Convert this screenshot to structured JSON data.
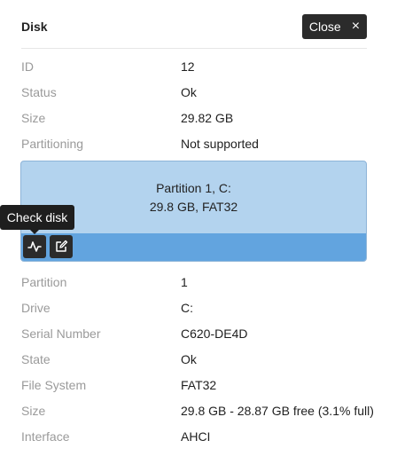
{
  "header": {
    "title": "Disk",
    "close_label": "Close",
    "close_icon": "×"
  },
  "disk": [
    {
      "label": "ID",
      "value": "12"
    },
    {
      "label": "Status",
      "value": "Ok"
    },
    {
      "label": "Size",
      "value": "29.82 GB"
    },
    {
      "label": "Partitioning",
      "value": "Not supported"
    }
  ],
  "partition_card": {
    "line1": "Partition 1, C:",
    "line2": "29.8 GB, FAT32",
    "tooltip": "Check disk",
    "check_icon": "activity-icon",
    "edit_icon": "edit-icon"
  },
  "partition": [
    {
      "label": "Partition",
      "value": "1"
    },
    {
      "label": "Drive",
      "value": "C:"
    },
    {
      "label": "Serial Number",
      "value": "C620-DE4D"
    },
    {
      "label": "State",
      "value": "Ok"
    },
    {
      "label": "File System",
      "value": "FAT32"
    },
    {
      "label": "Size",
      "value": "29.8 GB - 28.87 GB free (3.1% full)"
    },
    {
      "label": "Interface",
      "value": "AHCI"
    }
  ],
  "colors": {
    "card_bg": "#b3d3ee",
    "card_bar": "#62a4df",
    "button_dark": "#2b2b2b"
  }
}
